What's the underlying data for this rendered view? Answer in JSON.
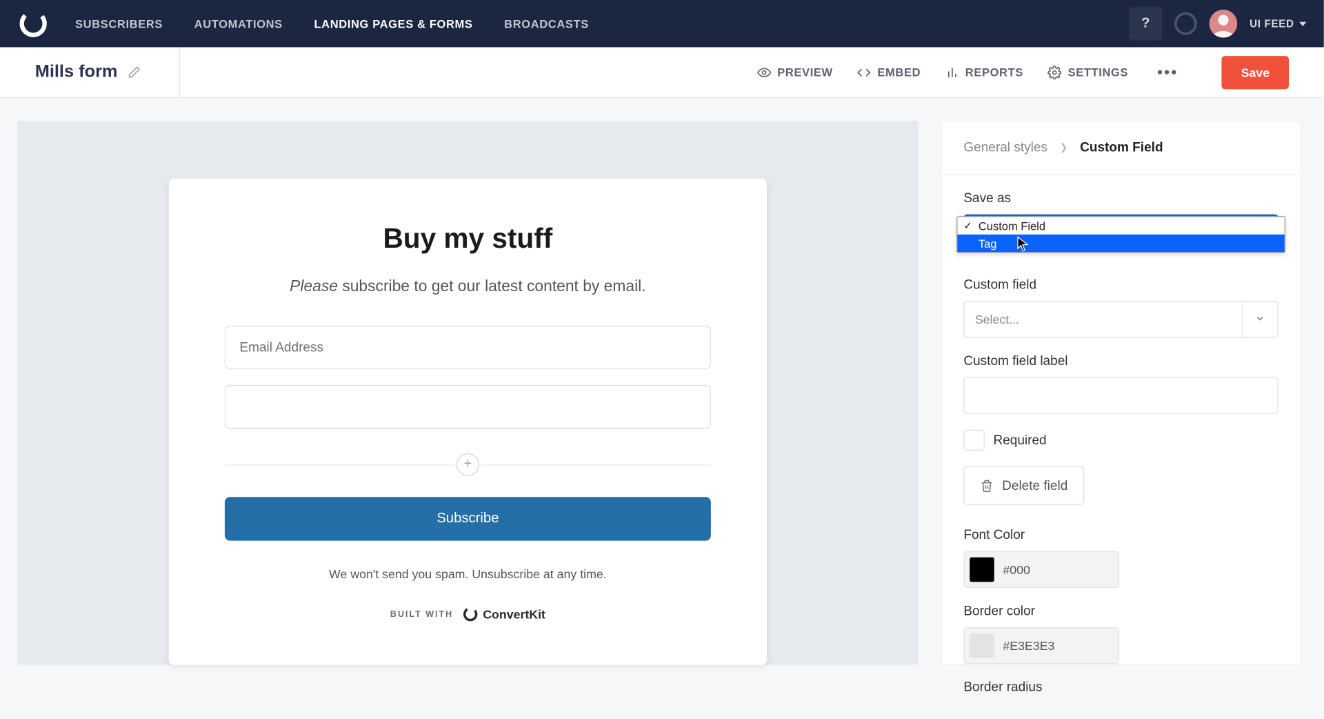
{
  "topnav": {
    "links": [
      "SUBSCRIBERS",
      "AUTOMATIONS",
      "LANDING PAGES & FORMS",
      "BROADCASTS"
    ],
    "help": "?",
    "user_label": "UI FEED"
  },
  "subheader": {
    "title": "Mills form",
    "toolbar": {
      "preview": "PREVIEW",
      "embed": "EMBED",
      "reports": "REPORTS",
      "settings": "SETTINGS"
    },
    "save": "Save"
  },
  "form_preview": {
    "heading": "Buy my stuff",
    "sub_emph": "Please",
    "sub_rest": " subscribe to get our latest content by email.",
    "email_placeholder": "Email Address",
    "submit": "Subscribe",
    "disclaimer": "We won't send you spam. Unsubscribe at any time.",
    "built_with": "BUILT WITH",
    "ck_brand": "ConvertKit"
  },
  "sidepanel": {
    "crumbs": {
      "prev": "General styles",
      "current": "Custom Field"
    },
    "save_as": {
      "label": "Save as",
      "options": [
        "Custom Field",
        "Tag"
      ],
      "selected": "Custom Field",
      "hovered": "Tag"
    },
    "custom_field": {
      "label": "Custom field",
      "placeholder": "Select...",
      "label_field_label": "Custom field label",
      "label_value": ""
    },
    "required_label": "Required",
    "delete_label": "Delete field",
    "font_color": {
      "label": "Font Color",
      "value": "#000",
      "swatch": "#000000"
    },
    "border_color": {
      "label": "Border color",
      "value": "#E3E3E3",
      "swatch": "#E3E3E3"
    },
    "border_radius": {
      "label": "Border radius"
    }
  }
}
